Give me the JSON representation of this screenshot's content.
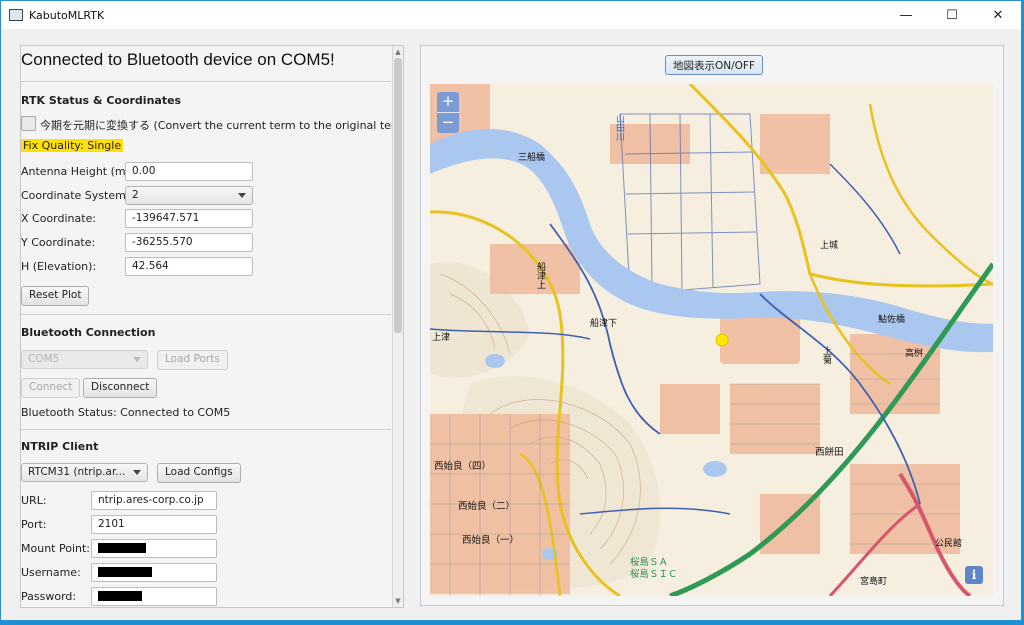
{
  "window": {
    "title": "KabutoMLRTK"
  },
  "header": {
    "title": "Connected to Bluetooth device on COM5!"
  },
  "rtk": {
    "section_title": "RTK Status & Coordinates",
    "convert_label": "今期を元期に変換する (Convert the current term to the original term)",
    "convert_checked": false,
    "fix_quality": "Fix Quality: Single",
    "fix_quality_color": "#ffe000",
    "antenna_label": "Antenna Height (m):",
    "antenna_value": "0.00",
    "coord_system_label": "Coordinate System:",
    "coord_system_value": "2",
    "x_label": "X Coordinate:",
    "x_value": "-139647.571",
    "y_label": "Y Coordinate:",
    "y_value": "-36255.570",
    "h_label": "H (Elevation):",
    "h_value": "42.564",
    "reset_button": "Reset Plot"
  },
  "bluetooth": {
    "section_title": "Bluetooth Connection",
    "port_value": "COM5",
    "load_ports_button": "Load Ports",
    "connect_button": "Connect",
    "disconnect_button": "Disconnect",
    "status": "Bluetooth Status: Connected to COM5"
  },
  "ntrip": {
    "section_title": "NTRIP Client",
    "config_value": "RTCM31 (ntrip.ar...",
    "load_configs_button": "Load Configs",
    "url_label": "URL:",
    "url_value": "ntrip.ares-corp.co.jp",
    "port_label": "Port:",
    "port_value": "2101",
    "mount_label": "Mount Point:",
    "username_label": "Username:",
    "password_label": "Password:"
  },
  "map": {
    "toggle_button": "地図表示ON/OFF",
    "zoom_in": "+",
    "zoom_out": "−",
    "info": "i",
    "position_color": "#ffe600",
    "labels": {
      "sanfunabashi": "三船橋",
      "yamadagawa": "山田川",
      "kamizu": "上津",
      "funatsu_ue": "船津上",
      "funatsu_shita": "船津下",
      "ayusa_bashi": "鮎佐橋",
      "kamiyoshi": "上菊",
      "takamasu": "高桝",
      "nishihajime": "西始良（四）",
      "nishihajime2": "西始良（二）",
      "nishihajime1": "西始良（一）",
      "sakurajima_sa": "桜島ＳＡ",
      "sakurajima_sic": "桜島ＳＩＣ",
      "kamiyuki_machi": "公民館",
      "miyajimacho": "宮島町",
      "nishimochida": "西餅田",
      "kamijo": "上城"
    }
  }
}
